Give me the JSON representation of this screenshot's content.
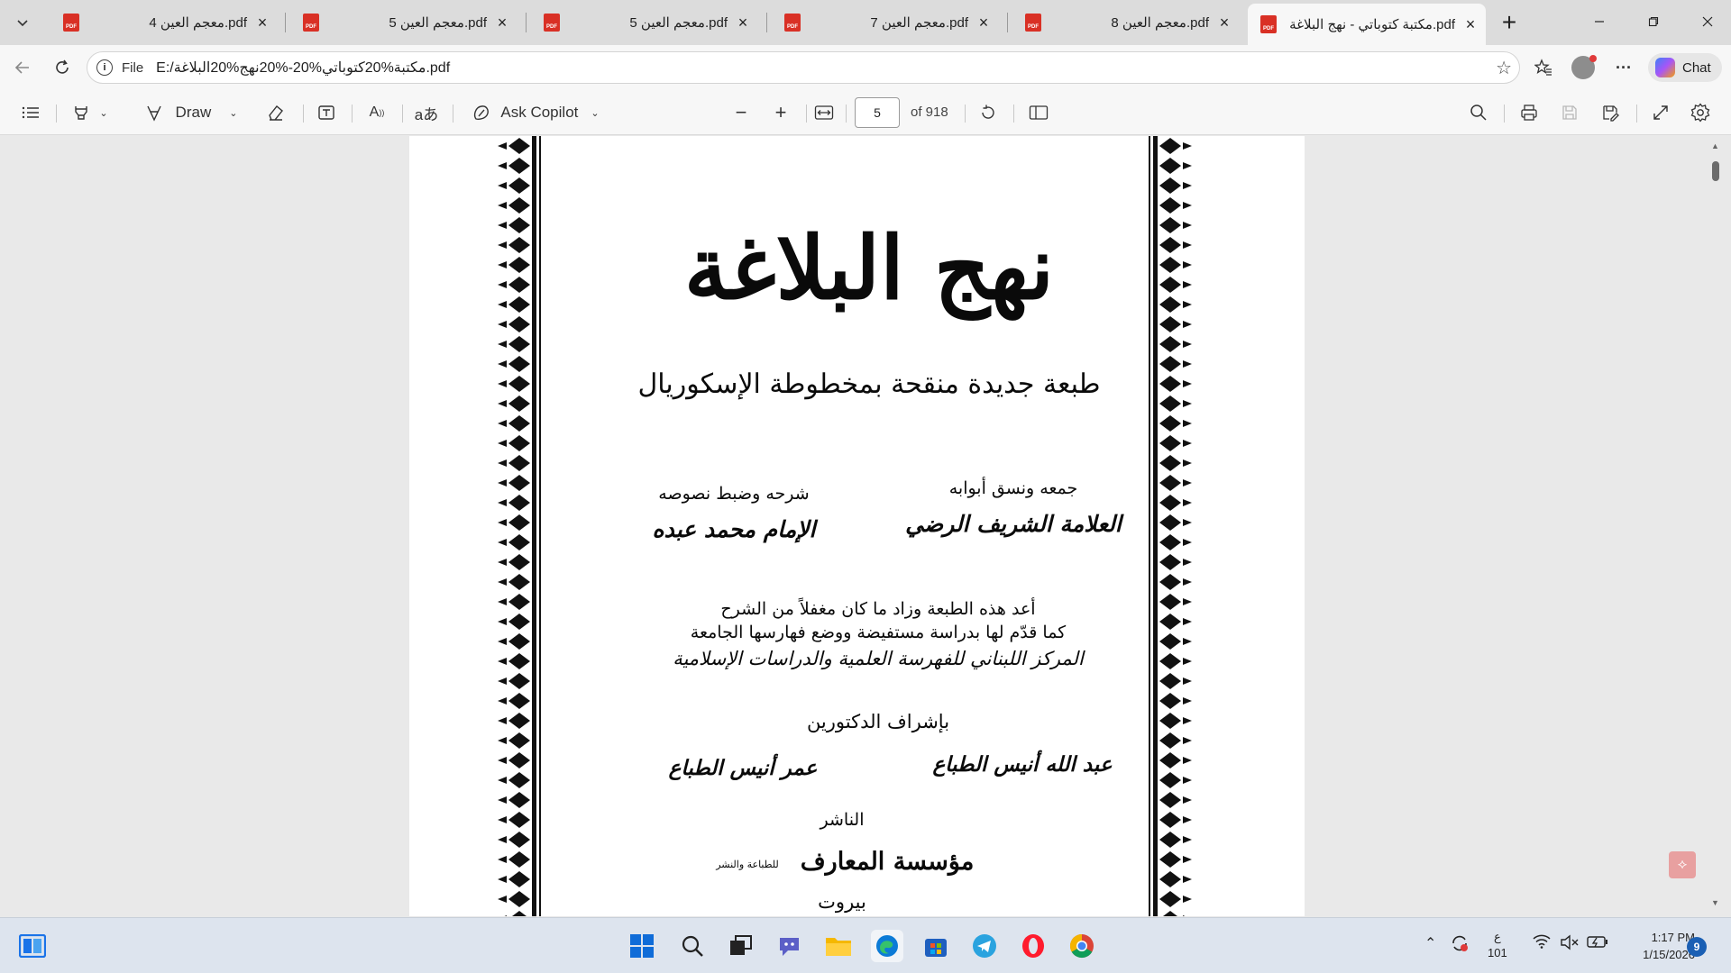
{
  "tabs": [
    {
      "title": "معجم العين 4.pdf",
      "active": false
    },
    {
      "title": "معجم العين 5.pdf",
      "active": false
    },
    {
      "title": "معجم العين 5.pdf",
      "active": false
    },
    {
      "title": "معجم العين 7.pdf",
      "active": false
    },
    {
      "title": "معجم العين 8.pdf",
      "active": false
    },
    {
      "title": "مكتبة كتوباتي - نهج البلاغة.pdf",
      "active": true
    }
  ],
  "pdf_icon_text": "PDF",
  "address": {
    "scheme": "File",
    "url": "E:/مكتبة%20كتوباتي%20-%20نهج%20البلاغة.pdf"
  },
  "chat_label": "Chat",
  "pdf_toolbar": {
    "draw_label": "Draw",
    "ask_copilot_label": "Ask Copilot",
    "page_number": "5",
    "page_total": "of 918"
  },
  "page_content": {
    "title": "نهج البلاغة",
    "subtitle": "طبعة جديدة منقحة بمخطوطة الإسكوريال",
    "right_caption": "جمعه ونسق أبوابه",
    "right_name": "العلامة الشريف الرضي",
    "left_caption": "شرحه وضبط نصوصه",
    "left_name": "الإمام محمد عبده",
    "para_1": "أعد هذه الطبعة وزاد ما كان مغفلاً من الشرح",
    "para_2": "كما قدّم لها بدراسة مستفيضة ووضع فهارسها الجامعة",
    "para_3": "المركز اللبناني للفهرسة العلمية والدراسات الإسلامية",
    "supervision": "بإشراف الدكتورين",
    "editor_right": "عبد الله أنيس الطباع",
    "editor_left": "عمر أنيس الطباع",
    "publisher_label": "الناشر",
    "publisher": "مؤسسة المعارف",
    "publisher_sub": "للطباعة والنشر",
    "city": "بيروت"
  },
  "taskbar": {
    "lang_line1": "ع",
    "lang_line2": "101",
    "time": "1:17 PM",
    "date": "1/15/2026",
    "notifications": "9"
  },
  "colors": {
    "tabstrip": "#dcdcdc",
    "toolbar": "#f7f7f7",
    "viewer_bg": "#e9e9e9",
    "pdf_red": "#d93025",
    "taskbar": "#dde4ee"
  },
  "icons": [
    "tab-menu-icon",
    "pdf-file-icon",
    "close-icon",
    "plus-icon",
    "minimize-icon",
    "restore-icon",
    "window-close-icon",
    "back-icon",
    "refresh-icon",
    "info-icon",
    "favorite-star-icon",
    "favorites-icon",
    "more-icon",
    "contents-icon",
    "highlight-icon",
    "draw-icon",
    "erase-icon",
    "text-box-icon",
    "read-aloud-icon",
    "translate-icon",
    "copilot-icon",
    "zoom-out-icon",
    "zoom-in-icon",
    "fit-page-icon",
    "rotate-icon",
    "page-view-icon",
    "search-icon",
    "print-icon",
    "save-icon",
    "save-as-icon",
    "fullscreen-icon",
    "settings-icon"
  ]
}
